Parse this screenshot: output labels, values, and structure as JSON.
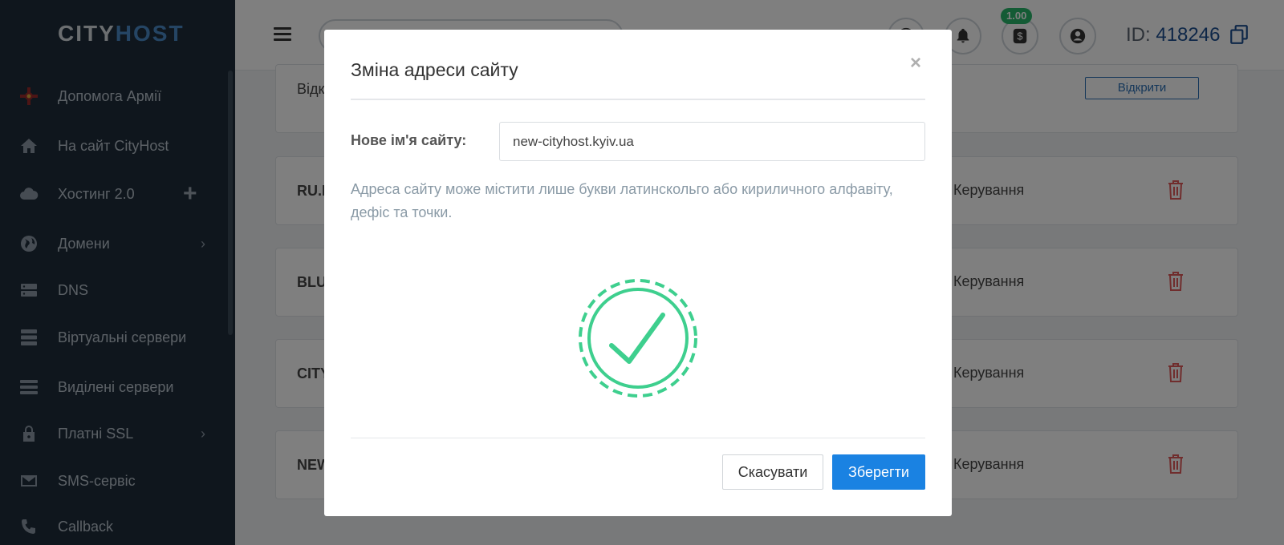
{
  "brand": {
    "logo_part1": "CITY",
    "logo_part2": "HOST"
  },
  "sidebar": {
    "items": [
      {
        "label": "Допомога Армії",
        "icon": "army-emblem-icon"
      },
      {
        "label": "На сайт CityHost",
        "icon": "home-icon"
      },
      {
        "label": "Хостинг 2.0",
        "icon": "cloud-icon",
        "extra": "plus-icon"
      },
      {
        "label": "Домени",
        "icon": "globe-icon",
        "extra": "chevron-right-icon"
      },
      {
        "label": "DNS",
        "icon": "server-icon"
      },
      {
        "label": "Віртуальні сервери",
        "icon": "server-stack-icon"
      },
      {
        "label": "Виділені сервери",
        "icon": "server-rack-icon"
      },
      {
        "label": "Платні SSL",
        "icon": "lock-icon",
        "extra": "chevron-right-icon"
      },
      {
        "label": "SMS-сервіс",
        "icon": "mail-icon"
      },
      {
        "label": "Callback",
        "icon": "phone-callback-icon"
      }
    ]
  },
  "topbar": {
    "balance": "1.00",
    "account_id_label": "ID:",
    "account_id": "418246"
  },
  "background_list": {
    "first_card_label": "Відк",
    "open_button": "Відкрити",
    "rows": [
      {
        "name": "RU.I",
        "manage": "Керування"
      },
      {
        "name": "BLU",
        "manage": "Керування"
      },
      {
        "name": "CITY",
        "manage": "Керування"
      },
      {
        "name": "NEW",
        "manage": "Керування"
      }
    ]
  },
  "modal": {
    "title": "Зміна адреси сайту",
    "close": "×",
    "field_label": "Нове ім'я сайту:",
    "field_value": "new-cityhost.kyiv.ua",
    "hint": "Адреса сайту може містити лише букви латинскольго або кириличного алфавіту, дефіс та точки.",
    "cancel": "Скасувати",
    "save": "Зберегти"
  },
  "colors": {
    "sidebar_bg": "#1e2d3b",
    "accent": "#1a82e2",
    "success": "#3ecf8e",
    "danger": "#e05a5a"
  }
}
